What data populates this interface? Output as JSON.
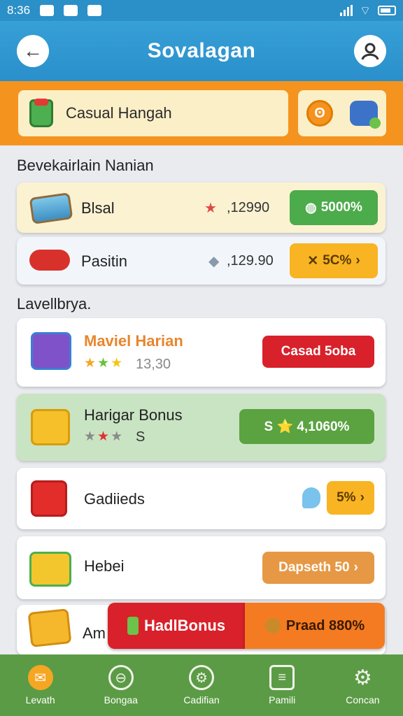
{
  "status": {
    "time": "8:36"
  },
  "header": {
    "title": "Sovalagan"
  },
  "banner": {
    "search_text": "Casual Hangah"
  },
  "section1": {
    "title": "Bevekairlain Nanian"
  },
  "list1": [
    {
      "label": "Blsal",
      "value": ",12990",
      "badge": "5000%",
      "badge_color": "#4cab4a"
    },
    {
      "label": "Pasitin",
      "value": ",129.90",
      "badge": "5C%",
      "badge_color": "#f8b423"
    }
  ],
  "section2": {
    "title": "Lavellbrya."
  },
  "list2": [
    {
      "label": "Maviel Harian",
      "rating_text": "13,30",
      "badge": "Casad 5oba",
      "badge_color": "#d8212a"
    },
    {
      "label": "Harigar Bonus",
      "rating_text": "S",
      "badge": "S ⭐ 4,1060%",
      "badge_color": "#5aa340"
    },
    {
      "label": "Gadiieds",
      "badge": "5%",
      "badge_color": "#f8b423"
    },
    {
      "label": "Hebei",
      "badge": "Dapseth 50",
      "badge_color": "#e69845"
    },
    {
      "label": "Am"
    }
  ],
  "promo": {
    "left": "HadlBonus",
    "right": "Praad 880%",
    "left_color": "#d8212a",
    "right_color": "#f47b22"
  },
  "nav": [
    {
      "label": "Levath",
      "icon": "chat-icon"
    },
    {
      "label": "Bongaa",
      "icon": "shield-icon"
    },
    {
      "label": "Cadifian",
      "icon": "gear-icon"
    },
    {
      "label": "Pamili",
      "icon": "menu-card-icon"
    },
    {
      "label": "Concan",
      "icon": "settings-icon"
    }
  ]
}
